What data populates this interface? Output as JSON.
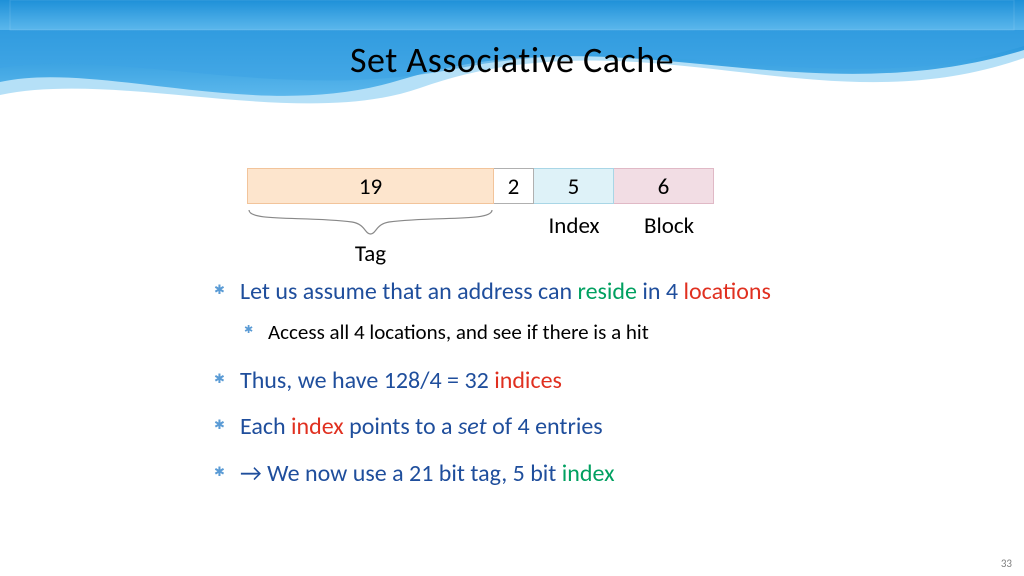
{
  "title": "Set Associative Cache",
  "addr": {
    "tag": "19",
    "gap": "2",
    "index": "5",
    "block": "6",
    "labels": {
      "tag": "Tag",
      "index": "Index",
      "block": "Block"
    }
  },
  "bullet1": {
    "t1": "Let us assume that an ",
    "address": "address",
    "t2": " can ",
    "reside": "reside",
    "t3": " in 4 ",
    "locations": "locations"
  },
  "sub1": "Access all 4 locations, and see if there is a hit",
  "bullet2": {
    "t1": "Thus, we have 128/4 = 32 ",
    "indices": "indices"
  },
  "bullet3": {
    "t1": "Each ",
    "index": "index",
    "t2": " points to a ",
    "set": "set",
    "t3": " of 4 entries"
  },
  "bullet4": {
    "arrow": "→",
    "t1": " We now use a 21 bit ",
    "tag": "tag",
    "t2": ", 5 bit ",
    "index": "index"
  },
  "page": "33"
}
